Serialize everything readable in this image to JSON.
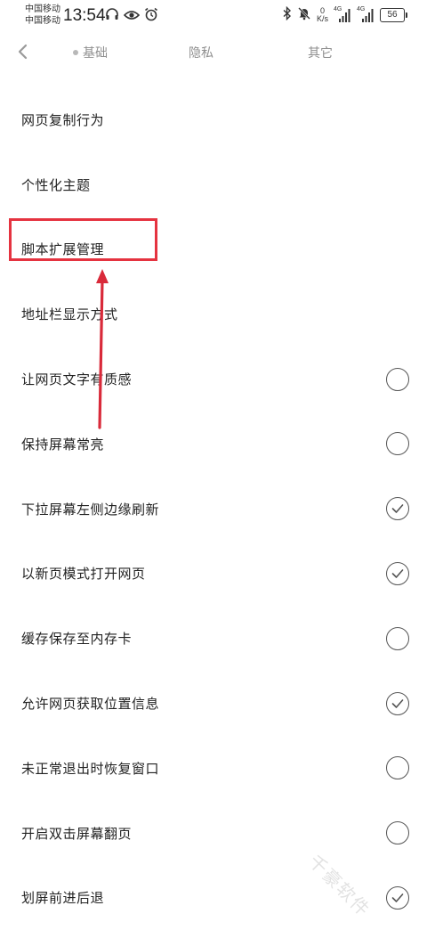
{
  "status_bar": {
    "carrier_1": "中国移动",
    "carrier_2": "中国移动",
    "time": "13:54",
    "left_icons": [
      "headphones-icon",
      "eye-icon",
      "alarm-icon"
    ],
    "right_icons": [
      "bluetooth-icon",
      "mute-icon"
    ],
    "net_speed_value": "0",
    "net_speed_unit": "K/s",
    "signal_1_tag": "4G",
    "signal_2_tag": "4G",
    "battery": "56"
  },
  "header": {
    "back_icon": "chevron-left-icon",
    "tabs": [
      {
        "label": "基础",
        "active": true
      },
      {
        "label": "隐私",
        "active": false
      },
      {
        "label": "其它",
        "active": false
      }
    ]
  },
  "settings": {
    "items": [
      {
        "label": "网页复制行为",
        "toggle": "none"
      },
      {
        "label": "个性化主题",
        "toggle": "none"
      },
      {
        "label": "脚本扩展管理",
        "toggle": "none"
      },
      {
        "label": "地址栏显示方式",
        "toggle": "none"
      },
      {
        "label": "让网页文字有质感",
        "toggle": "off"
      },
      {
        "label": "保持屏幕常亮",
        "toggle": "off"
      },
      {
        "label": "下拉屏幕左侧边缘刷新",
        "toggle": "on"
      },
      {
        "label": "以新页模式打开网页",
        "toggle": "on"
      },
      {
        "label": "缓存保存至内存卡",
        "toggle": "off"
      },
      {
        "label": "允许网页获取位置信息",
        "toggle": "on"
      },
      {
        "label": "未正常退出时恢复窗口",
        "toggle": "off"
      },
      {
        "label": "开启双击屏幕翻页",
        "toggle": "off"
      },
      {
        "label": "划屏前进后退",
        "toggle": "on"
      }
    ]
  },
  "annotation": {
    "highlight_color": "#e53340",
    "target_item": "脚本扩展管理"
  },
  "watermark": "千豪软件"
}
